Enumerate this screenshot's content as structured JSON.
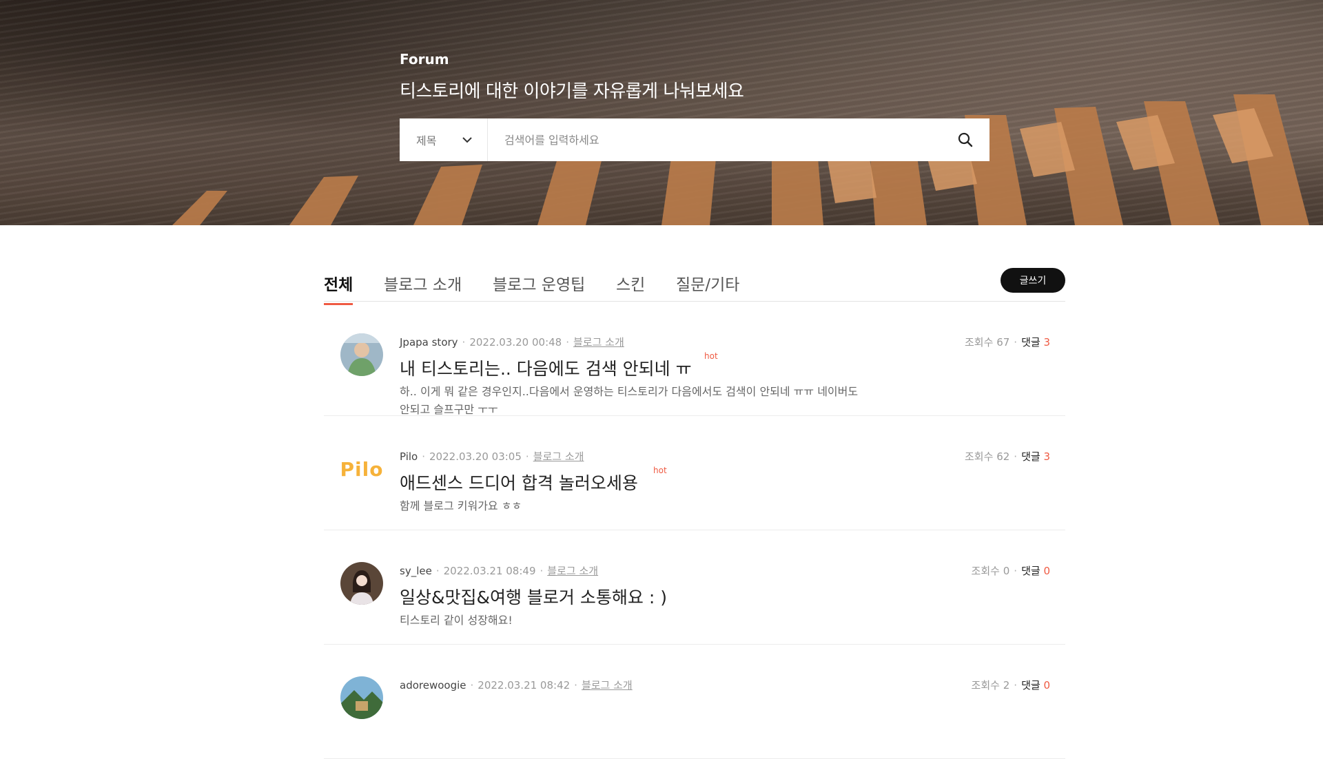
{
  "hero": {
    "label": "Forum",
    "title": "티스토리에 대한 이야기를 자유롭게 나눠보세요"
  },
  "search": {
    "select_value": "제목",
    "placeholder": "검색어를 입력하세요"
  },
  "tabs": [
    {
      "label": "전체",
      "active": true
    },
    {
      "label": "블로그 소개",
      "active": false
    },
    {
      "label": "블로그 운영팁",
      "active": false
    },
    {
      "label": "스킨",
      "active": false
    },
    {
      "label": "질문/기타",
      "active": false
    }
  ],
  "write_label": "글쓰기",
  "stats_labels": {
    "views": "조회수",
    "comments": "댓글"
  },
  "hot_label": "hot",
  "colors": {
    "accent": "#ef5a42",
    "write_button": "#111111"
  },
  "posts": [
    {
      "author": "Jpapa story",
      "date": "2022.03.20 00:48",
      "category": "블로그 소개",
      "title": "내 티스토리는.. 다음에도 검색 안되네 ㅠ",
      "hot": true,
      "body": "하.. 이게 뭐 같은 경우인지..다음에서 운영하는 티스토리가 다음에서도 검색이 안되네 ㅠㅠ 네이버도 안되고 슬프구만 ㅜㅜ",
      "views": "67",
      "comments": "3"
    },
    {
      "author": "Pilo",
      "date": "2022.03.20 03:05",
      "category": "블로그 소개",
      "title": "애드센스 드디어 합격 놀러오세용",
      "hot": true,
      "body": "함께 블로그 키워가요 ㅎㅎ",
      "views": "62",
      "comments": "3",
      "avatar_text": "Pilo"
    },
    {
      "author": "sy_lee",
      "date": "2022.03.21 08:49",
      "category": "블로그 소개",
      "title": "일상&맛집&여행 블로거 소통해요 : )",
      "hot": false,
      "body": "티스토리 같이 성장해요!",
      "views": "0",
      "comments": "0"
    },
    {
      "author": "adorewoogie",
      "date": "2022.03.21 08:42",
      "category": "블로그 소개",
      "title": "",
      "hot": false,
      "body": "",
      "views": "2",
      "comments": "0"
    }
  ]
}
